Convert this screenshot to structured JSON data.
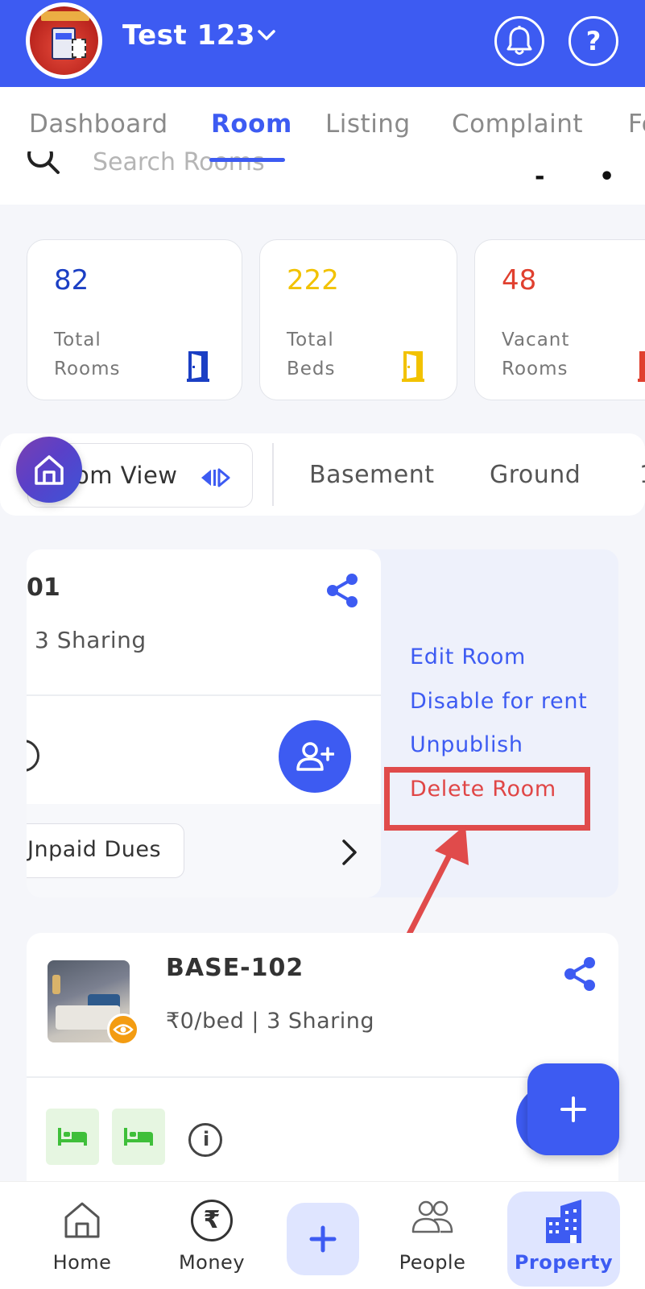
{
  "header": {
    "title": "Test 123",
    "bell_icon": "bell-icon",
    "help_label": "?"
  },
  "tabs": [
    {
      "label": "Dashboard",
      "active": false
    },
    {
      "label": "Room",
      "active": true
    },
    {
      "label": "Listing",
      "active": false
    },
    {
      "label": "Complaint",
      "active": false
    },
    {
      "label": "Fe",
      "active": false
    }
  ],
  "search": {
    "placeholder": "Search Rooms"
  },
  "stats": [
    {
      "value": "82",
      "label_line1": "Total",
      "label_line2": "Rooms",
      "color": "#1b3fc4"
    },
    {
      "value": "222",
      "label_line1": "Total",
      "label_line2": "Beds",
      "color": "#f2c200"
    },
    {
      "value": "48",
      "label_line1": "Vacant",
      "label_line2": "Rooms",
      "color": "#e0402f"
    }
  ],
  "floor_bar": {
    "room_view_label": "om View",
    "floors": [
      "Basement",
      "Ground",
      "1"
    ]
  },
  "room_card_1": {
    "room_number": "01",
    "sharing": "3 Sharing",
    "dues_label": "Jnpaid Dues"
  },
  "context_menu": {
    "edit": "Edit Room",
    "disable": "Disable for rent",
    "unpublish": "Unpublish",
    "delete": "Delete Room"
  },
  "room_card_2": {
    "room_number": "BASE-102",
    "price_sharing": "₹0/bed | 3 Sharing"
  },
  "bottom_nav": {
    "home": "Home",
    "money": "Money",
    "money_symbol": "₹",
    "people": "People",
    "property": "Property"
  },
  "colors": {
    "primary": "#3d5bf2",
    "danger": "#e04646",
    "bed_green": "#3fbf3a",
    "badge_orange": "#f39c12"
  }
}
